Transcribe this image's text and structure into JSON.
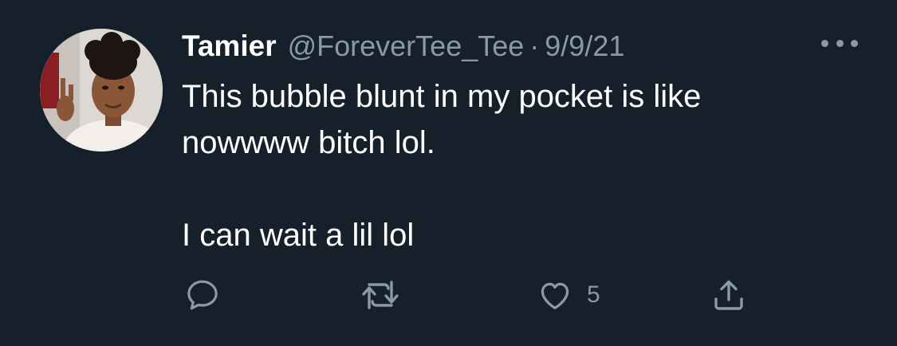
{
  "tweet": {
    "author_name": "Tamier",
    "handle": "@ForeverTee_Tee",
    "separator": "·",
    "date": "9/9/21",
    "text_lines": [
      "This bubble blunt in my pocket is like",
      "nowwww bitch lol."
    ],
    "text_line_2": "I can wait a lil lol",
    "like_count": "5"
  },
  "icons": {
    "reply": "reply-icon",
    "retweet": "retweet-icon",
    "like": "heart-icon",
    "share": "share-icon",
    "more": "more-icon"
  },
  "colors": {
    "background": "#15202b",
    "primary_text": "#ffffff",
    "secondary_text": "#8b98a5"
  }
}
